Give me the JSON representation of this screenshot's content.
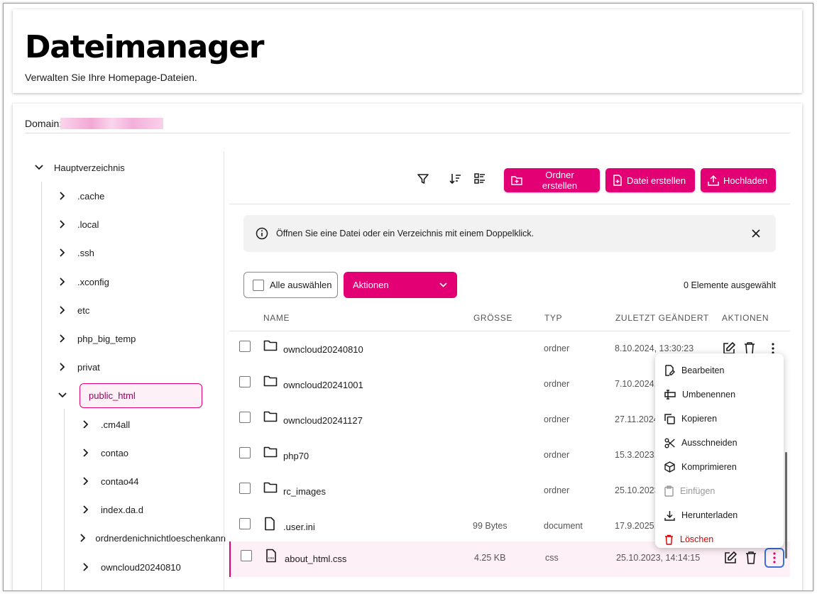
{
  "header": {
    "title": "Dateimanager",
    "subtitle": "Verwalten Sie Ihre Homepage-Dateien."
  },
  "domain": {
    "label": "Domain:"
  },
  "tree": {
    "root": "Hauptverzeichnis",
    "children": [
      ".cache",
      ".local",
      ".ssh",
      ".xconfig",
      "etc",
      "php_big_temp",
      "privat",
      "public_html"
    ],
    "selected": "public_html",
    "public_html_children": [
      ".cm4all",
      "contao",
      "contao44",
      "index.da.d",
      "ordnerdenichnichtloeschenkann",
      "owncloud20240810"
    ]
  },
  "toolbar": {
    "filter_icon": "filter-icon",
    "sort_icon": "sort-icon",
    "view_icon": "view-toggle-icon",
    "create_folder": "Ordner erstellen",
    "create_file": "Datei erstellen",
    "upload": "Hochladen"
  },
  "info_message": "Öffnen Sie eine Datei oder ein Verzeichnis mit einem Doppelklick.",
  "selection": {
    "select_all": "Alle auswählen",
    "actions": "Aktionen",
    "count_text": "0 Elemente ausgewählt"
  },
  "table": {
    "headers": [
      "NAME",
      "GRÖSSE",
      "TYP",
      "ZULETZT GEÄNDERT",
      "AKTIONEN"
    ],
    "rows": [
      {
        "name": "owncloud20240810",
        "size": "",
        "type": "ordner",
        "date": "8.10.2024, 13:30:23",
        "icon": "folder-icon"
      },
      {
        "name": "owncloud20241001",
        "size": "",
        "type": "ordner",
        "date": "7.10.2024,",
        "icon": "folder-icon"
      },
      {
        "name": "owncloud20241127",
        "size": "",
        "type": "ordner",
        "date": "27.11.2024",
        "icon": "folder-icon"
      },
      {
        "name": "php70",
        "size": "",
        "type": "ordner",
        "date": "15.3.2023,",
        "icon": "folder-icon"
      },
      {
        "name": "rc_images",
        "size": "",
        "type": "ordner",
        "date": "25.10.2023",
        "icon": "folder-icon"
      },
      {
        "name": ".user.ini",
        "size": "99 Bytes",
        "type": "document",
        "date": "17.9.2025,",
        "icon": "file-icon"
      },
      {
        "name": "about_html.css",
        "size": "4.25 KB",
        "type": "css",
        "date": "25.10.2023, 14:14:15",
        "icon": "css-file-icon"
      }
    ]
  },
  "context_menu": {
    "items": [
      {
        "label": "Bearbeiten",
        "icon": "edit-file-icon"
      },
      {
        "label": "Umbenennen",
        "icon": "rename-icon"
      },
      {
        "label": "Kopieren",
        "icon": "copy-icon"
      },
      {
        "label": "Ausschneiden",
        "icon": "scissors-icon"
      },
      {
        "label": "Komprimieren",
        "icon": "box-icon"
      },
      {
        "label": "Einfügen",
        "icon": "clipboard-icon"
      },
      {
        "label": "Herunterladen",
        "icon": "download-icon"
      },
      {
        "label": "Löschen",
        "icon": "trash-icon"
      }
    ]
  },
  "colors": {
    "accent": "#e20074",
    "danger": "#d90000",
    "focus": "#3b6fd9"
  }
}
